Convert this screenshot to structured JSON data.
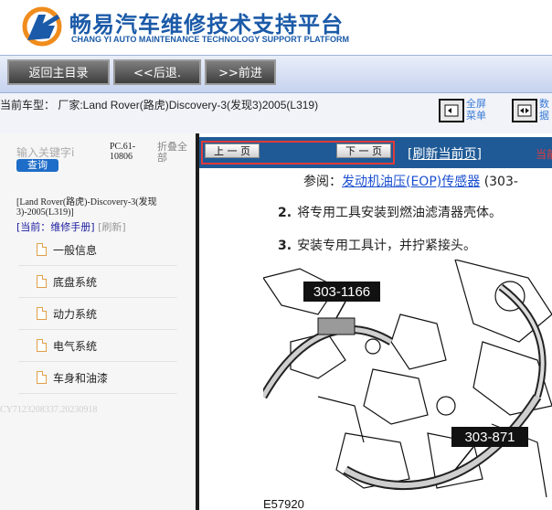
{
  "header": {
    "brand_cn": "畅易汽车维修技术支持平台",
    "brand_en": "CHANG YI AUTO MAINTENANCE TECHNOLOGY SUPPORT PLATFORM"
  },
  "toolbar": {
    "home_label": "返回主目录",
    "back_label": "<<后退.",
    "forward_label": ">>前进"
  },
  "model_bar": {
    "text": "当前车型： 厂家:Land Rover(路虎)Discovery-3(发现3)2005(L319)",
    "fullscreen_label": "全屏菜单",
    "data_label": "数据"
  },
  "left_panel": {
    "search_placeholder": "输入关键字i",
    "query_label": "查询",
    "pc_code": "PC.61-10806",
    "fold_all": "折叠全部",
    "model_small": "[Land Rover(路虎)-Discovery-3(发现3)-2005(L319)]",
    "current_prefix": "[当前：维修手册]",
    "refresh_label": "[刷新]",
    "menu": [
      "一般信息",
      "底盘系统",
      "动力系统",
      "电气系统",
      "车身和油漆"
    ],
    "footer_code": "CY7123208337.20230918"
  },
  "right_panel": {
    "prev_label": "上 一 页",
    "next_label": "下 一 页",
    "refresh_current": "[刷新当前页]",
    "current_label": "当前",
    "ref_prefix": "参阅：",
    "ref_link": "发动机油压(EOP)传感器",
    "ref_suffix": "(303-",
    "steps": [
      {
        "num": "2.",
        "text": "将专用工具安装到燃油滤清器壳体。"
      },
      {
        "num": "3.",
        "text": "安装专用工具计，并拧紧接头。"
      }
    ],
    "figure_labels": [
      "303-1166",
      "303-871"
    ],
    "figure_id": "E57920"
  },
  "colors": {
    "brand_blue": "#1b5aa8",
    "nav_blue": "#1f5a96",
    "highlight_red": "#e03b3b",
    "link_blue": "#1a4fd0"
  }
}
